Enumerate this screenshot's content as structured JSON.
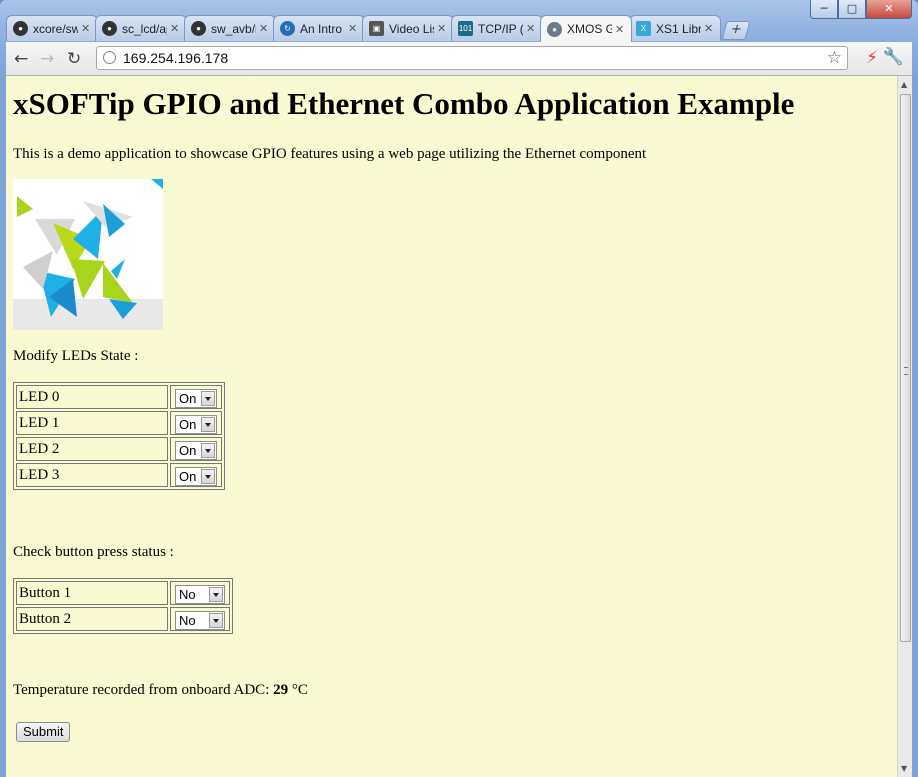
{
  "window": {
    "controls": [
      "minimize",
      "maximize",
      "close"
    ]
  },
  "tabs": [
    {
      "label": "xcore/sw",
      "icon": "github-icon",
      "color": "#333333"
    },
    {
      "label": "sc_lcd/ap",
      "icon": "github-icon",
      "color": "#333333"
    },
    {
      "label": "sw_avb/i",
      "icon": "github-icon",
      "color": "#333333"
    },
    {
      "label": "An Intro",
      "icon": "refresh-c-icon",
      "color": "#2a6cb3"
    },
    {
      "label": "Video Lis",
      "icon": "image-icon",
      "color": "#555555"
    },
    {
      "label": "TCP/IP (",
      "icon": "binary-101-icon",
      "color": "#1d6b8a"
    },
    {
      "label": "XMOS G",
      "icon": "globe-icon",
      "color": "#6b7b8c",
      "active": true
    },
    {
      "label": "XS1 Libr",
      "icon": "xmos-x-icon",
      "color": "#38a8d8"
    }
  ],
  "toolbar": {
    "url": "169.254.196.178"
  },
  "page": {
    "background": "#fafad2",
    "title": "xSOFTip GPIO and Ethernet Combo Application Example",
    "intro": "This is a demo application to showcase GPIO features using a web page utilizing the Ethernet component",
    "leds_heading": "Modify LEDs State :",
    "leds": [
      {
        "label": "LED 0",
        "value": "On"
      },
      {
        "label": "LED 1",
        "value": "On"
      },
      {
        "label": "LED 2",
        "value": "On"
      },
      {
        "label": "LED 3",
        "value": "On"
      }
    ],
    "buttons_heading": "Check button press status :",
    "buttons": [
      {
        "label": "Button 1",
        "value": "No"
      },
      {
        "label": "Button 2",
        "value": "No"
      }
    ],
    "temp_prefix": "Temperature recorded from onboard ADC: ",
    "temp_value": "29 ",
    "temp_unit": "°C",
    "submit_label": "Submit"
  }
}
